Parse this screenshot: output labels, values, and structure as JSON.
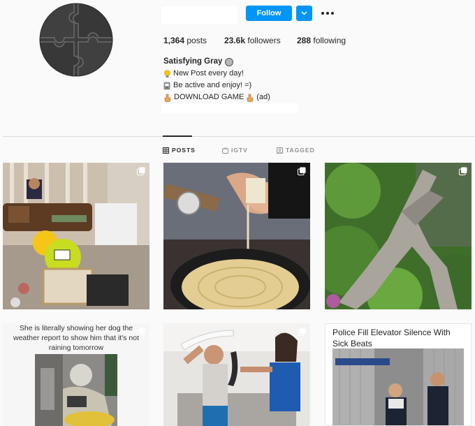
{
  "profile": {
    "follow_label": "Follow",
    "stats": {
      "posts_count": "1,364",
      "posts_label": "posts",
      "followers_count": "23.6k",
      "followers_label": "followers",
      "following_count": "288",
      "following_label": "following"
    },
    "bio": {
      "name": "Satisfying Gray",
      "line1": "New Post every day!",
      "line2": "Be active and enjoy! =)",
      "line3_a": "DOWNLOAD GAME",
      "line3_b": "(ad)"
    }
  },
  "tabs": [
    {
      "label": "POSTS",
      "icon": "grid-icon",
      "active": true
    },
    {
      "label": "IGTV",
      "icon": "igtv-icon",
      "active": false
    },
    {
      "label": "TAGGED",
      "icon": "tag-icon",
      "active": false
    }
  ],
  "posts": [
    {
      "caption": "",
      "icon": "multi-post-icon"
    },
    {
      "caption": "",
      "icon": "multi-post-icon"
    },
    {
      "caption": "",
      "icon": "multi-post-icon"
    },
    {
      "caption": "She is literally showing her dog the weather report to show him that it's not raining tomorrow",
      "icon": "multi-post-icon"
    },
    {
      "caption": "",
      "icon": "multi-post-icon"
    },
    {
      "caption": "Police Fill Elevator Silence With Sick Beats",
      "icon": ""
    }
  ],
  "colors": {
    "accent": "#0095f6",
    "background": "#fafafa",
    "divider": "#dbdbdb",
    "text_primary": "#262626",
    "text_secondary": "#8e8e8e"
  }
}
